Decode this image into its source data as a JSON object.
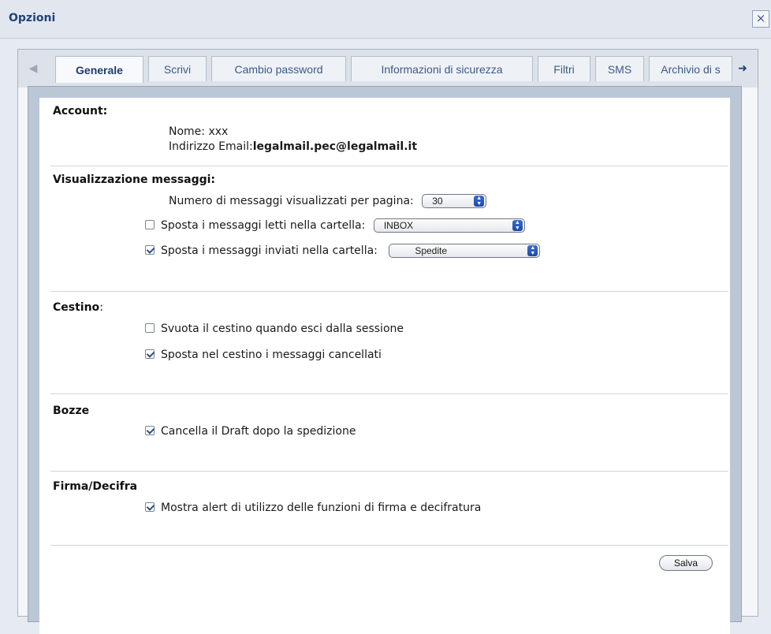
{
  "window": {
    "title": "Opzioni",
    "close_icon": "×"
  },
  "tabs": {
    "scroll_left_icon": "arrow-left",
    "scroll_right_icon": "arrow-right",
    "items": [
      {
        "label": "Generale"
      },
      {
        "label": "Scrivi"
      },
      {
        "label": "Cambio password"
      },
      {
        "label": "Informazioni di sicurezza"
      },
      {
        "label": "Filtri"
      },
      {
        "label": "SMS"
      },
      {
        "label": "Archivio di s"
      }
    ]
  },
  "account": {
    "heading": "Account:",
    "name_label": "Nome:",
    "name_value": "xxx",
    "email_label": "Indirizzo Email:",
    "email_value": "legalmail.pec@legalmail.it"
  },
  "view": {
    "heading": "Visualizzazione messaggi:",
    "per_page_label": "Numero di messaggi visualizzati per pagina:",
    "per_page_value": "30",
    "move_read_label": "Sposta i messaggi letti nella cartella:",
    "move_read_checked": false,
    "move_read_folder": "INBOX",
    "move_sent_label": "Sposta i messaggi inviati nella cartella:",
    "move_sent_checked": true,
    "move_sent_folder": "Spedite"
  },
  "trash": {
    "heading": "Cestino",
    "heading_suffix": ":",
    "empty_on_exit_label": "Svuota il cestino quando esci dalla sessione",
    "empty_on_exit_checked": false,
    "move_deleted_label": "Sposta nel cestino i messaggi cancellati",
    "move_deleted_checked": true
  },
  "drafts": {
    "heading": "Bozze",
    "delete_after_send_label": "Cancella il Draft dopo la spedizione",
    "delete_after_send_checked": true
  },
  "sign": {
    "heading": "Firma/Decifra",
    "show_alert_label": "Mostra alert di utilizzo delle funzioni di firma e decifratura",
    "show_alert_checked": true
  },
  "actions": {
    "save_label": "Salva"
  },
  "colors": {
    "title": "#21427a",
    "tab_text": "#3c5a87",
    "inner_border": "#bcc7d6"
  }
}
